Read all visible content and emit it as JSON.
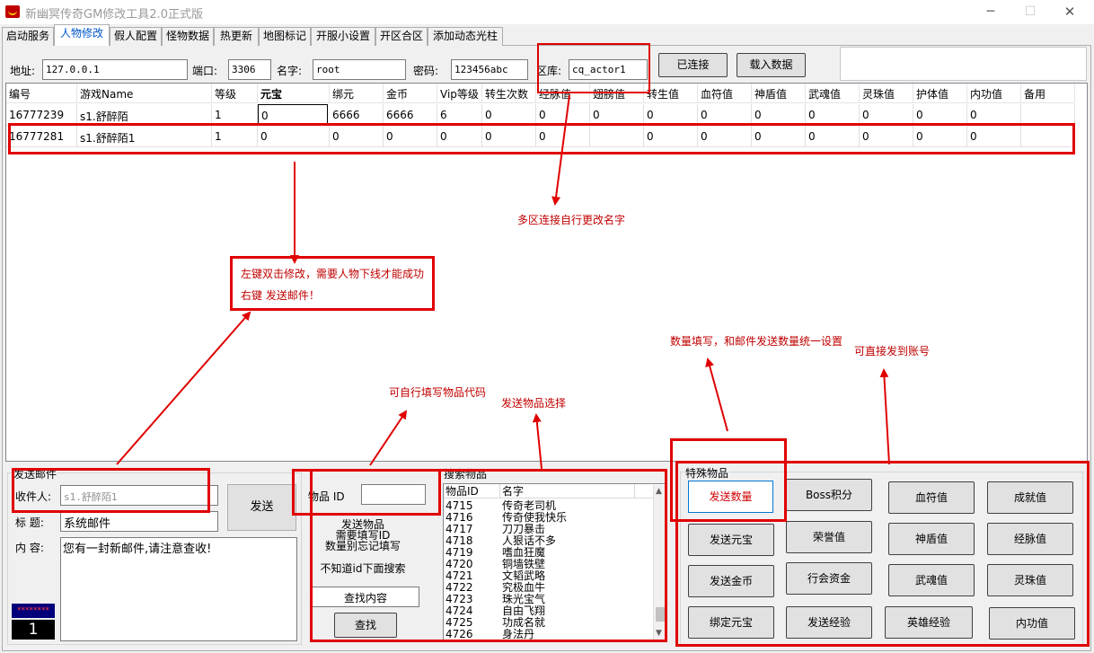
{
  "window": {
    "title": "新幽冥传奇GM修改工具2.0正式版",
    "minimize": "─",
    "maximize": "☐",
    "close": "✕"
  },
  "tabs": [
    "启动服务",
    "人物修改",
    "假人配置",
    "怪物数据",
    "热更新",
    "地图标记",
    "开服小设置",
    "开区合区",
    "添加动态光柱"
  ],
  "connection": {
    "address_label": "地址:",
    "address": "127.0.0.1",
    "port_label": "端口:",
    "port": "3306",
    "name_label": "名字:",
    "name": "root",
    "password_label": "密码:",
    "password": "123456abc",
    "db_label": "区库:",
    "db": "cq_actor1",
    "connect_button": "已连接",
    "load_button": "载入数据"
  },
  "grid": {
    "columns": [
      "编号",
      "游戏Name",
      "等级",
      "元宝",
      "绑元",
      "金币",
      "Vip等级",
      "转生次数",
      "经脉值",
      "翅膀值",
      "转生值",
      "血符值",
      "神盾值",
      "武魂值",
      "灵珠值",
      "护体值",
      "内功值",
      "备用"
    ],
    "rows": [
      [
        "16777239",
        "s1.舒醉陌",
        "1",
        "0",
        "6666",
        "6666",
        "6",
        "0",
        "0",
        "0",
        "0",
        "0",
        "0",
        "0",
        "0",
        "0",
        "0",
        ""
      ],
      [
        "16777281",
        "s1.舒醉陌1",
        "1",
        "0",
        "0",
        "0",
        "0",
        "0",
        "0",
        "",
        "0",
        "0",
        "0",
        "0",
        "0",
        "0",
        "0",
        ""
      ]
    ]
  },
  "annotations": {
    "multi_zone": "多区连接自行更改名字",
    "double_click_line1": "左键双击修改，需要人物下线才能成功",
    "double_click_line2": "右键   发送邮件！",
    "quantity": "数量填写，和邮件发送数量统一设置",
    "send_account": "可直接发到账号",
    "item_code": "可自行填写物品代码",
    "item_select": "发送物品选择"
  },
  "mail": {
    "group_title": "发送邮件",
    "recipient_label": "收件人:",
    "recipient": "s1.舒醉陌1",
    "subject_label": "标   题:",
    "subject": "系统邮件",
    "content_label": "内   容:",
    "content": "您有一封新邮件,请注意查收!",
    "send_button": "发送",
    "stars": "********",
    "counter": "1"
  },
  "item_panel": {
    "id_label": "物品 ID",
    "id_value": "",
    "hint_line1": "发送物品",
    "hint_line2": "需要填写ID",
    "hint_line3": "数量别忘记填写",
    "unknown_hint": "不知道id下面搜索",
    "search_placeholder": "查找内容",
    "search_button": "查找"
  },
  "search": {
    "group_title": "搜索物品",
    "columns": [
      "物品ID",
      "名字"
    ],
    "items": [
      [
        "4715",
        "传奇老司机"
      ],
      [
        "4716",
        "传奇使我快乐"
      ],
      [
        "4717",
        "刀刀暴击"
      ],
      [
        "4718",
        "人狠话不多"
      ],
      [
        "4719",
        "嗜血狂魔"
      ],
      [
        "4720",
        "铜墙铁壁"
      ],
      [
        "4721",
        "文韬武略"
      ],
      [
        "4722",
        "究极血牛"
      ],
      [
        "4723",
        "珠光宝气"
      ],
      [
        "4724",
        "自由飞翔"
      ],
      [
        "4725",
        "功成名就"
      ],
      [
        "4726",
        "身法丹"
      ]
    ]
  },
  "special": {
    "group_title": "特殊物品",
    "buttons": [
      [
        "发送数量",
        "Boss积分",
        "血符值",
        "成就值"
      ],
      [
        "发送元宝",
        "荣誉值",
        "神盾值",
        "经脉值"
      ],
      [
        "发送金币",
        "行会资金",
        "武魂值",
        "灵珠值"
      ],
      [
        "绑定元宝",
        "发送经验",
        "英雄经验",
        "内功值"
      ]
    ]
  }
}
